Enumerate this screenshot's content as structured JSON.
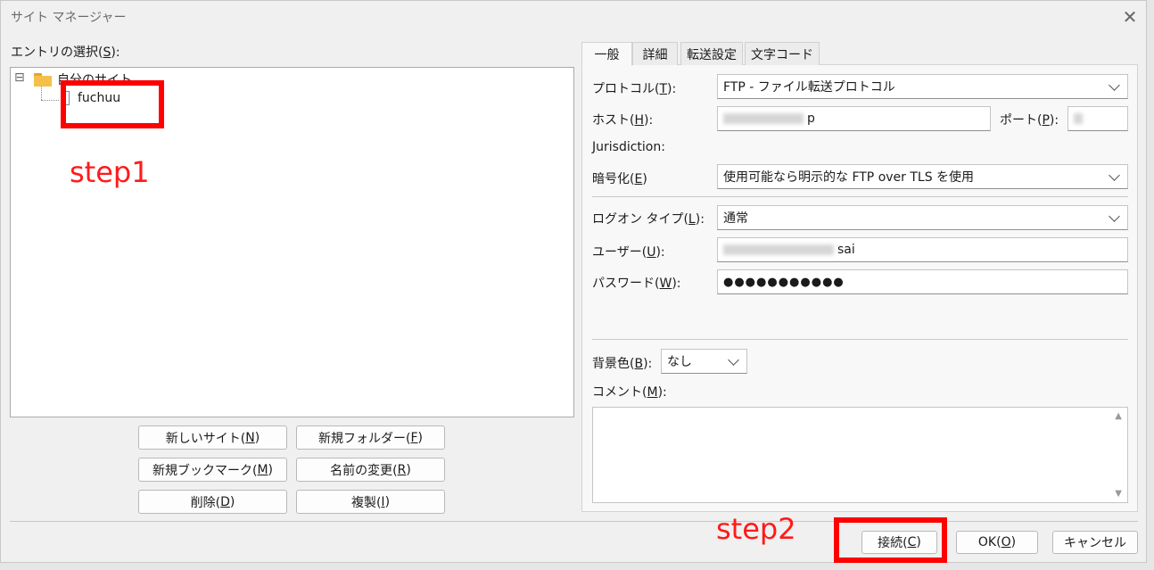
{
  "window": {
    "title": "サイト マネージャー",
    "close_glyph": "✕"
  },
  "left": {
    "label_prefix": "エントリの選択(",
    "label_key": "S",
    "label_suffix": "):",
    "tree": {
      "root": "自分のサイト",
      "child": "fuchuu",
      "expander": "⊟"
    },
    "buttons": [
      {
        "pre": "新しいサイト(",
        "key": "N",
        "post": ")"
      },
      {
        "pre": "新規フォルダー(",
        "key": "F",
        "post": ")"
      },
      {
        "pre": "新規ブックマーク(",
        "key": "M",
        "post": ")"
      },
      {
        "pre": "名前の変更(",
        "key": "R",
        "post": ")"
      },
      {
        "pre": "削除(",
        "key": "D",
        "post": ")"
      },
      {
        "pre": "複製(",
        "key": "I",
        "post": ")"
      }
    ]
  },
  "tabs": [
    "一般",
    "詳細",
    "転送設定",
    "文字コード"
  ],
  "general": {
    "protocol": {
      "pre": "プロトコル(",
      "key": "T",
      "post": "):",
      "value": "FTP - ファイル転送プロトコル"
    },
    "host": {
      "pre": "ホスト(",
      "key": "H",
      "post": "):",
      "value_tail": "p"
    },
    "port": {
      "pre": "ポート(",
      "key": "P",
      "post": "):"
    },
    "jurisdiction": {
      "key": "J",
      "rest": "urisdiction:"
    },
    "encryption": {
      "pre": "暗号化(",
      "key": "E",
      "post": ")",
      "value": "使用可能なら明示的な FTP over TLS を使用"
    },
    "logon": {
      "pre": "ログオン タイプ(",
      "key": "L",
      "post": "):",
      "value": "通常"
    },
    "user": {
      "pre": "ユーザー(",
      "key": "U",
      "post": "):",
      "value_tail": "sai"
    },
    "password": {
      "pre": "パスワード(",
      "key": "W",
      "post": "):",
      "value": "●●●●●●●●●●●"
    },
    "bgcolor": {
      "pre": "背景色(",
      "key": "B",
      "post": "):",
      "value": "なし"
    },
    "comment": {
      "pre": "コメント(",
      "key": "M",
      "post": "):"
    },
    "scroll_up": "▲",
    "scroll_down": "▼"
  },
  "footer": {
    "connect": {
      "pre": "接続(",
      "key": "C",
      "post": ")"
    },
    "ok": {
      "pre": "OK(",
      "key": "O",
      "post": ")"
    },
    "cancel": "キャンセル"
  },
  "annotations": {
    "step1": "step1",
    "step2": "step2"
  },
  "colors": {
    "annotation_red": "#ff0000",
    "folder_yellow": "#f5c04a"
  }
}
